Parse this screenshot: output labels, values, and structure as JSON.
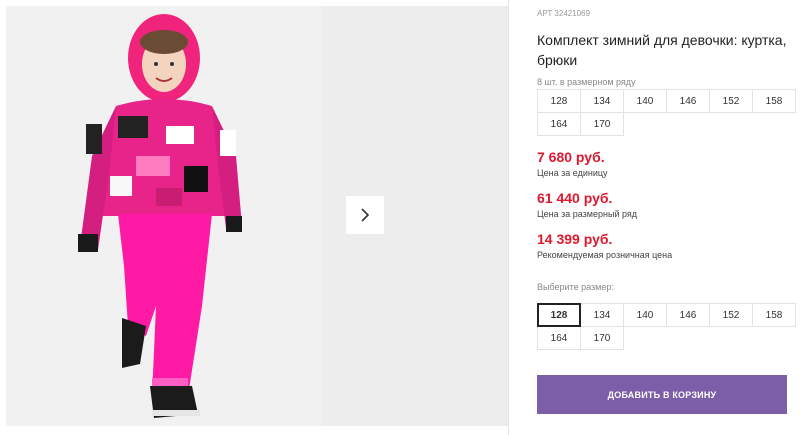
{
  "product": {
    "sku": "АРТ 32421069",
    "title": "Комплект зимний для девочки: куртка, брюки"
  },
  "pack": {
    "label": "8 шт. в размерном ряду",
    "sizes": [
      "128",
      "134",
      "140",
      "146",
      "152",
      "158",
      "164",
      "170"
    ]
  },
  "prices": {
    "unit_price": "7 680 руб.",
    "unit_caption": "Цена за единицу",
    "row_price": "61 440 руб.",
    "row_caption": "Цена за размерный ряд",
    "retail_price": "14 399 руб.",
    "retail_caption": "Рекомендуемая розничная цена",
    "price_color": "#e0182d"
  },
  "size_picker": {
    "label": "Выберите размер:",
    "sizes": [
      "128",
      "134",
      "140",
      "146",
      "152",
      "158",
      "164",
      "170"
    ],
    "selected": "128"
  },
  "cart": {
    "button_label": "ДОБАВИТЬ В КОРЗИНУ",
    "color": "#7b5ea7"
  },
  "gallery": {
    "next_icon": "chevron-right-icon"
  }
}
